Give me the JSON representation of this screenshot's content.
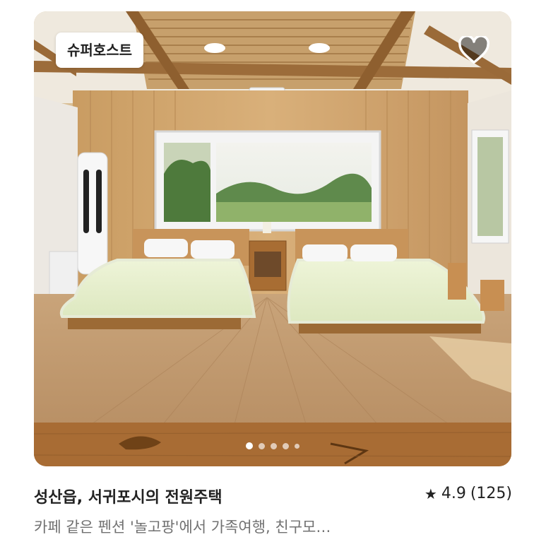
{
  "listing": {
    "badge": "슈퍼호스트",
    "title": "성산읍, 서귀포시의 전원주택",
    "rating": "4.9",
    "review_count": "(125)",
    "description": "카페 같은 펜션 '놀고팡'에서 가족여행, 친구모…",
    "photo_count": 5,
    "active_photo": 1
  },
  "icons": {
    "wishlist": "heart-icon",
    "rating": "star-icon"
  },
  "colors": {
    "text_primary": "#222222",
    "text_secondary": "#717171",
    "badge_bg": "#ffffff"
  }
}
